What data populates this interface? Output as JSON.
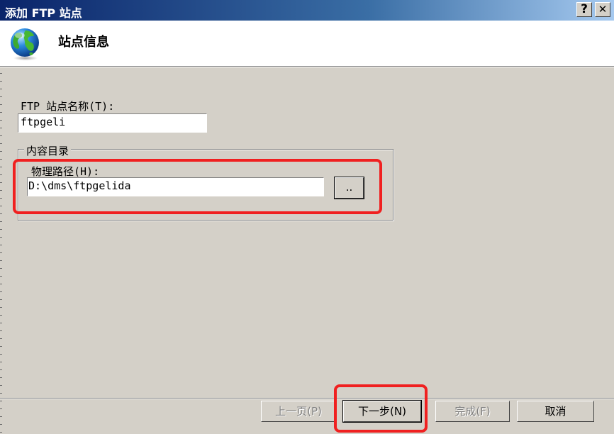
{
  "window": {
    "title": "添加 FTP 站点",
    "help_button": "?",
    "close_button": "✕"
  },
  "header": {
    "title": "站点信息",
    "icon": "globe-icon"
  },
  "form": {
    "site_name_label": "FTP 站点名称(T):",
    "site_name_value": "ftpgeli",
    "content_group_label": "内容目录",
    "physical_path_label": "物理路径(H):",
    "physical_path_value": "D:\\dms\\ftpgelida",
    "browse_button": ".."
  },
  "footer": {
    "back_button": "上一页(P)",
    "next_button": "下一步(N)",
    "finish_button": "完成(F)",
    "cancel_button": "取消"
  },
  "colors": {
    "titlebar_start": "#0a246a",
    "titlebar_end": "#a6caf0",
    "highlight": "#f02020",
    "face": "#d4d0c8"
  }
}
